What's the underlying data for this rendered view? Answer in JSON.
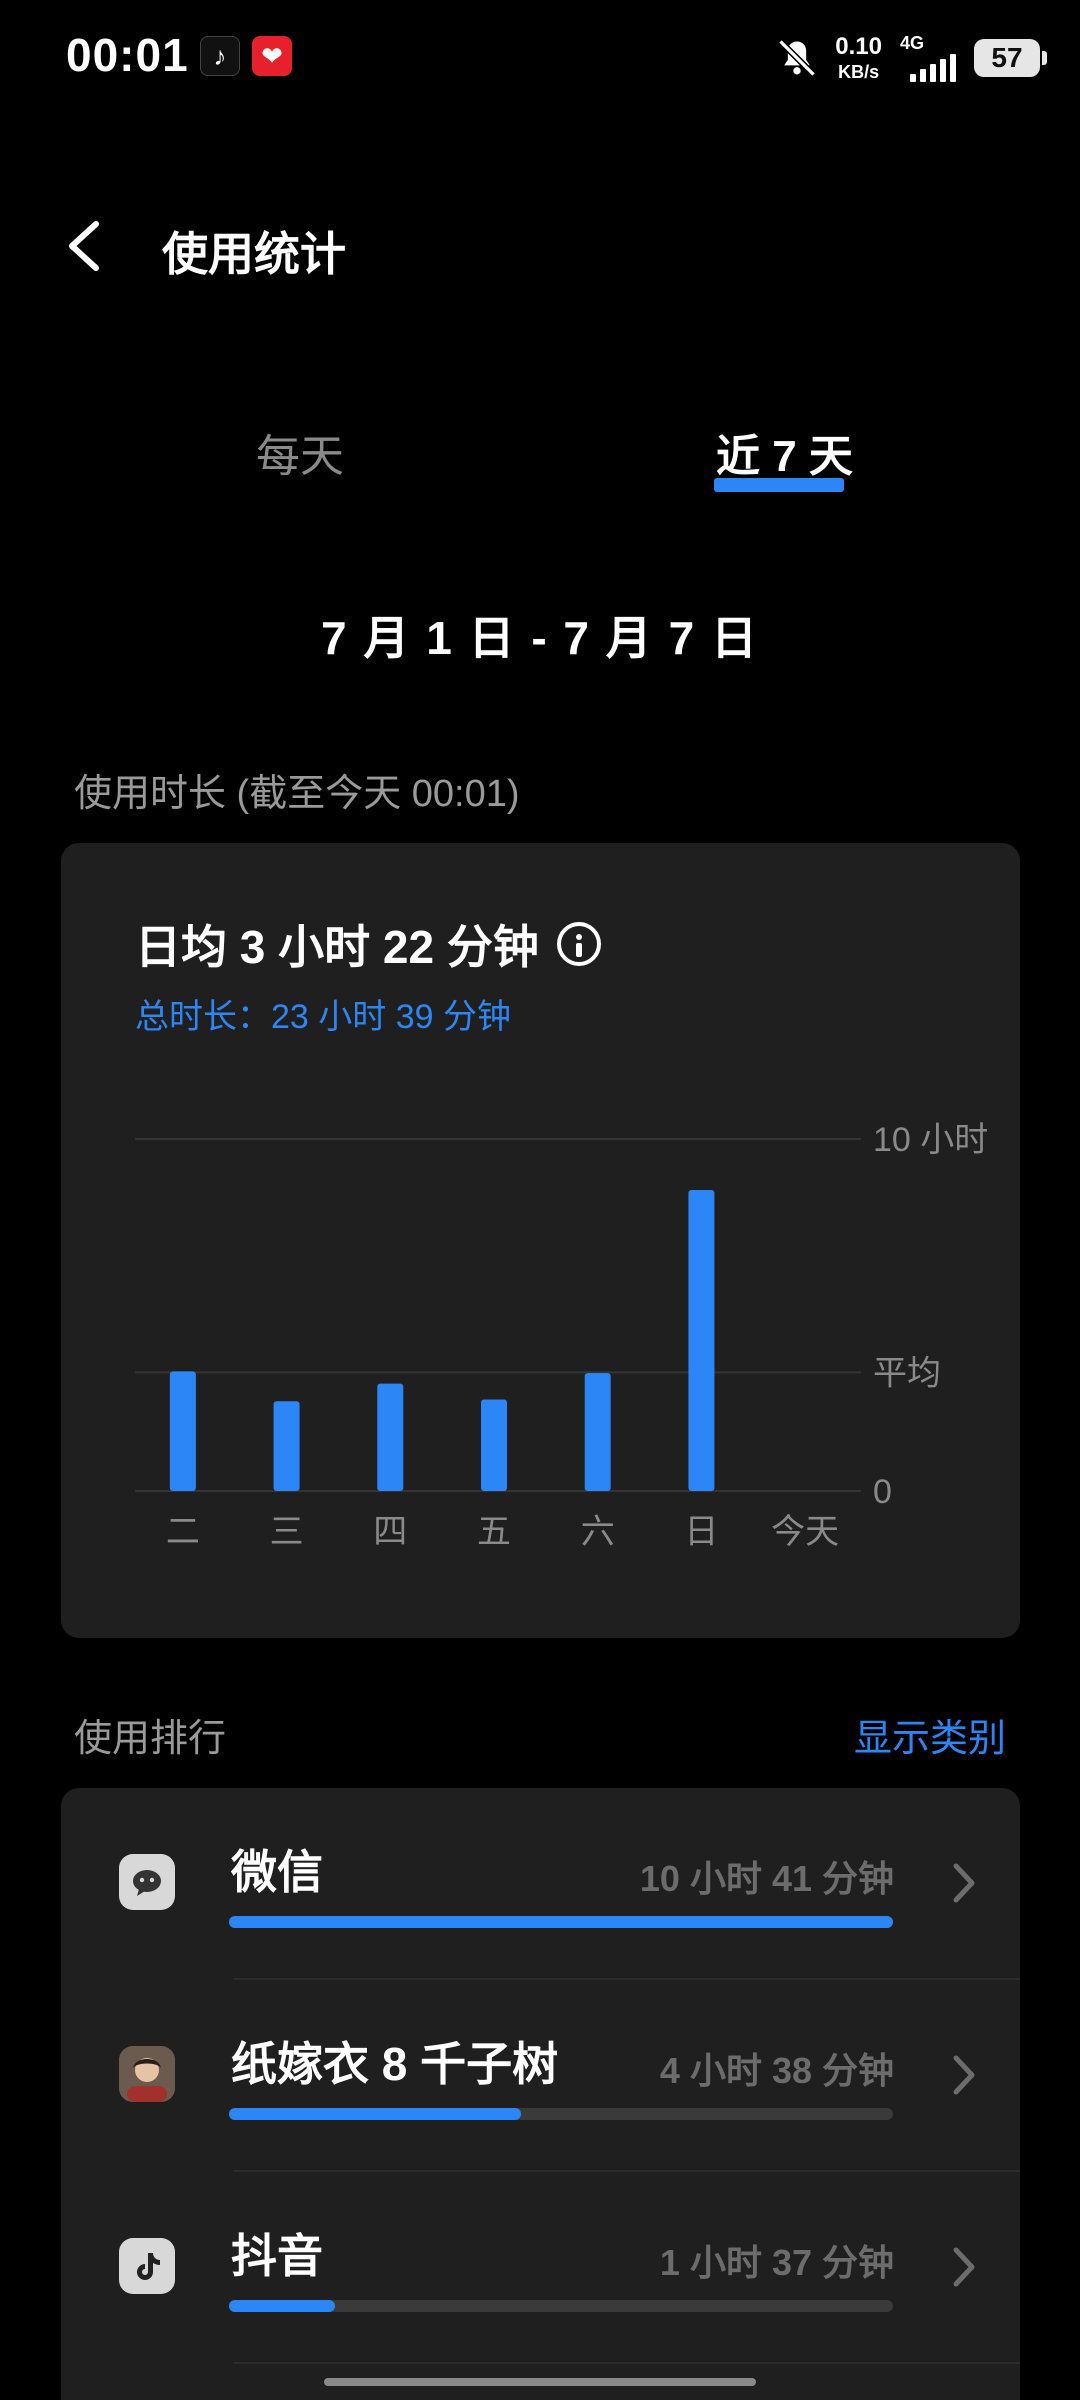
{
  "status": {
    "time": "00:01",
    "net_speed": "0.10",
    "net_unit": "KB/s",
    "network": "4G",
    "battery": "57",
    "icons": [
      "tiktok-notification-icon",
      "red-app-notification-icon",
      "bell-muted-icon",
      "signal-icon"
    ]
  },
  "header": {
    "title": "使用统计"
  },
  "tabs": {
    "daily": "每天",
    "weekly": "近 7 天",
    "selected": "weekly"
  },
  "date_range": "7 月 1 日 - 7 月 7 日",
  "usage_section": {
    "label": "使用时长 (截至今天 00:01)"
  },
  "summary": {
    "average": "日均 3 小时 22 分钟",
    "total": "总时长：23 小时 39 分钟"
  },
  "chart_data": {
    "type": "bar",
    "categories": [
      "二",
      "三",
      "四",
      "五",
      "六",
      "日",
      "今天"
    ],
    "values": [
      3.4,
      2.55,
      3.05,
      2.6,
      3.35,
      8.55,
      0
    ],
    "ylim": [
      0,
      10
    ],
    "y_ticks": [
      {
        "value": 10,
        "label": "10 小时"
      },
      {
        "value": 3.37,
        "label": "平均"
      },
      {
        "value": 0,
        "label": "0"
      }
    ],
    "bar_color": "#2d86f5",
    "grid": true
  },
  "ranking": {
    "label": "使用排行",
    "show_category": "显示类别",
    "items": [
      {
        "name": "微信",
        "duration": "10 小时 41 分钟",
        "ratio": 1.0,
        "icon": "wechat-icon"
      },
      {
        "name": "纸嫁衣 8 千子树",
        "duration": "4 小时 38 分钟",
        "ratio": 0.44,
        "icon": "game-avatar-icon"
      },
      {
        "name": "抖音",
        "duration": "1 小时 37 分钟",
        "ratio": 0.16,
        "icon": "douyin-icon"
      }
    ]
  },
  "colors": {
    "accent": "#2d86f5",
    "card": "#1f1f1f",
    "background": "#000000"
  }
}
